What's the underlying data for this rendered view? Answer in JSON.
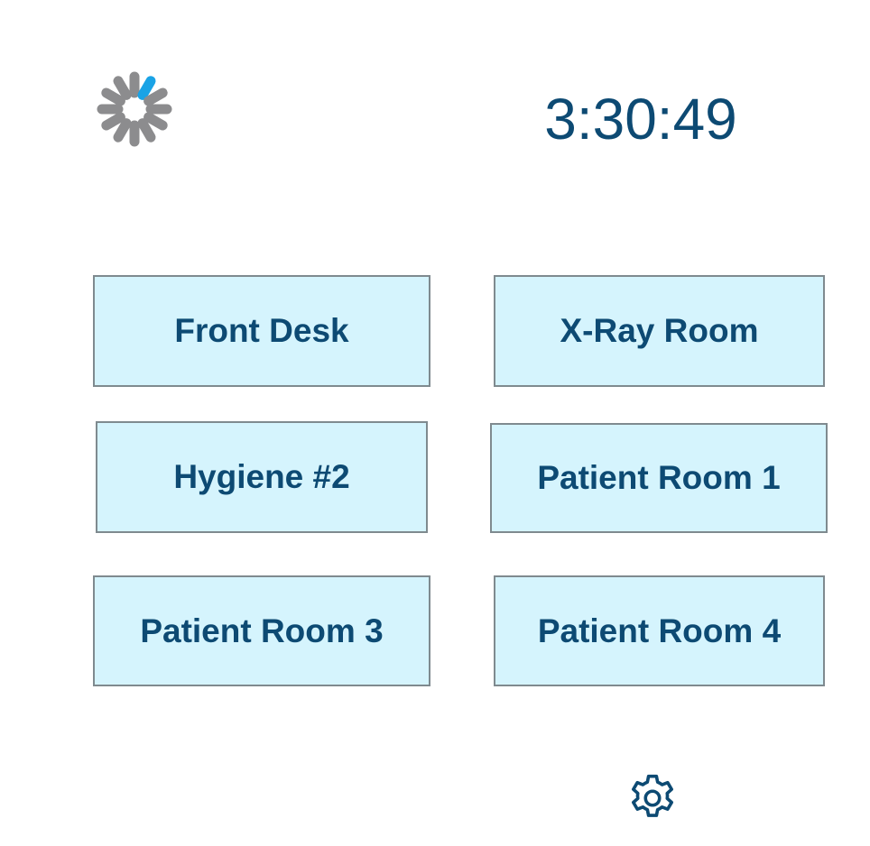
{
  "colors": {
    "accent": "#0d4a73",
    "button_background": "#d5f4fd",
    "button_border": "#7f8a8f",
    "spinner_gray": "#8c8c8e",
    "spinner_highlight": "#1aa3e6"
  },
  "status": {
    "spinner_icon": "loading-spinner-icon"
  },
  "clock": {
    "time": "3:30:49"
  },
  "rooms": [
    {
      "label": "Front Desk"
    },
    {
      "label": "X-Ray Room"
    },
    {
      "label": "Hygiene #2"
    },
    {
      "label": "Patient Room 1"
    },
    {
      "label": "Patient Room 3"
    },
    {
      "label": "Patient Room 4"
    }
  ],
  "footer": {
    "settings_icon": "gear-icon"
  }
}
